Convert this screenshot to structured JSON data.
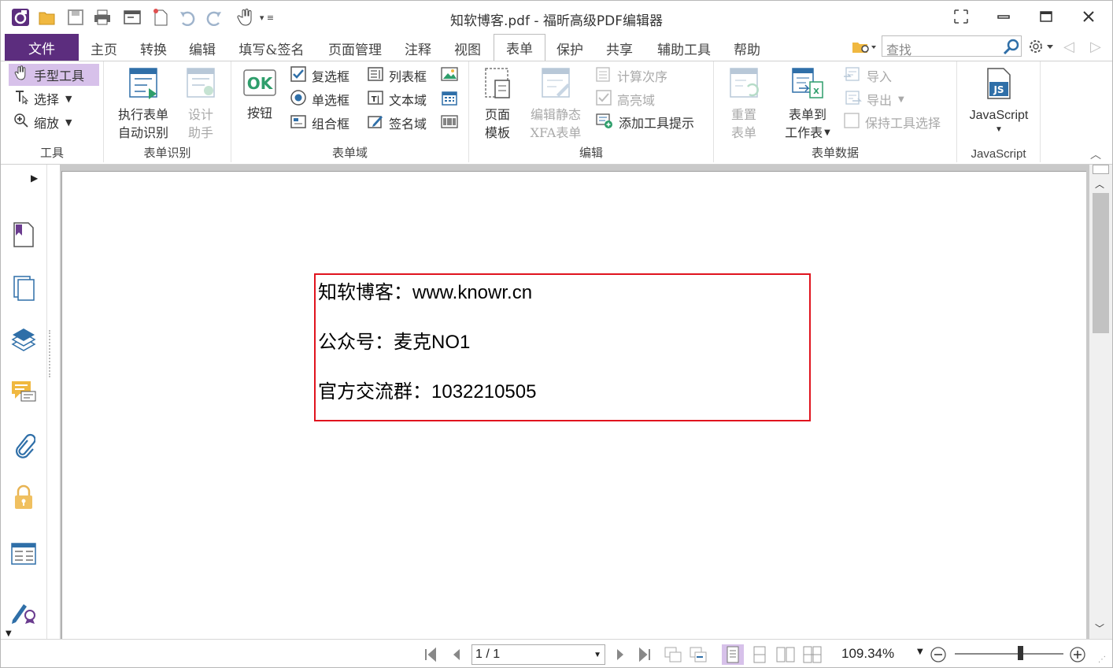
{
  "app": {
    "title": "知软博客.pdf - 福昕高级PDF编辑器",
    "colors": {
      "accent": "#5c2d7e",
      "highlight": "#d7c1ea",
      "box": "#e0141e",
      "icon": "#2f6fa8"
    }
  },
  "quick_access": [
    "app-logo-icon",
    "open-icon",
    "save-icon",
    "print-icon",
    "window-icon",
    "new-icon",
    "undo-icon",
    "redo-icon",
    "hand-icon",
    "customize-icon"
  ],
  "menu": {
    "tabs": [
      "文件",
      "主页",
      "转换",
      "编辑",
      "填写&签名",
      "页面管理",
      "注释",
      "视图",
      "表单",
      "保护",
      "共享",
      "辅助工具",
      "帮助"
    ],
    "active": "表单",
    "search_placeholder": "查找"
  },
  "ribbon": {
    "tools": {
      "hand": "手型工具",
      "select": "选择",
      "zoom": "缩放",
      "label": "工具"
    },
    "recog": {
      "run1": "执行表单",
      "run2": "自动识别",
      "design1": "设计",
      "design2": "助手",
      "label": "表单识别"
    },
    "fields": {
      "button": "按钮",
      "checkbox": "复选框",
      "radio": "单选框",
      "combo": "组合框",
      "listbox": "列表框",
      "textfield": "文本域",
      "signature": "签名域",
      "label": "表单域"
    },
    "edit": {
      "page1": "页面",
      "page2": "模板",
      "xfa1": "编辑静态",
      "xfa2": "XFA表单",
      "calc": "计算次序",
      "highlight": "高亮域",
      "tooltip": "添加工具提示",
      "label": "编辑"
    },
    "data": {
      "reset1": "重置",
      "reset2": "表单",
      "toSheet1": "表单到",
      "toSheet2": "工作表",
      "import": "导入",
      "export": "导出",
      "keep": "保持工具选择",
      "label": "表单数据"
    },
    "js": {
      "title": "JavaScript",
      "label": "JavaScript"
    }
  },
  "document": {
    "lines": [
      "知软博客：www.knowr.cn",
      "公众号：麦克NO1",
      "官方交流群：1032210505"
    ]
  },
  "status": {
    "page": "1 / 1",
    "zoom": "109.34%",
    "zoom_level": 0.6
  }
}
